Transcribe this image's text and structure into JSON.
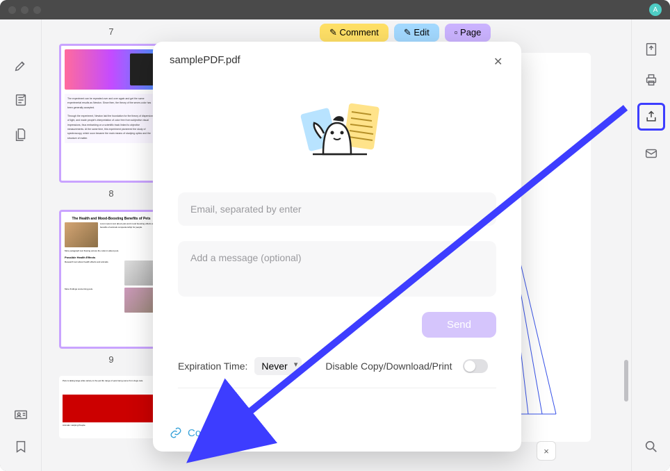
{
  "avatar_initial": "A",
  "thumbnails": {
    "page7": "7",
    "page8": "8",
    "page9": "9",
    "thumb9_title": "The Health and Mood-Boosting Benefits of Pets",
    "thumb9_heading": "Possible Health Effects"
  },
  "top_buttons": {
    "comment": "Comment",
    "edit": "Edit",
    "page": "Page"
  },
  "modal": {
    "title": "samplePDF.pdf",
    "email_placeholder": "Email, separated by enter",
    "message_placeholder": "Add a message (optional)",
    "send_label": "Send",
    "expiration_label": "Expiration Time:",
    "expiration_value": "Never",
    "disable_label": "Disable Copy/Download/Print",
    "copy_link_label": "Copy Link"
  },
  "bottom_close": "×",
  "colors": {
    "highlight": "#3d3dff",
    "accent_purple": "#d5c5fc",
    "link": "#3aa3d9"
  }
}
